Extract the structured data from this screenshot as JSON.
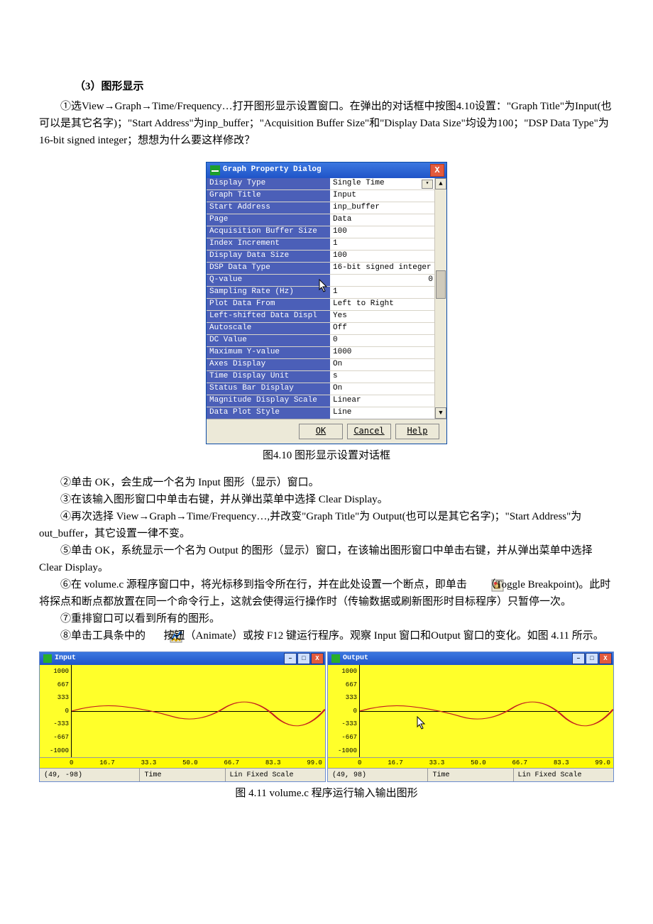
{
  "heading": "（3）图形显示",
  "para1": "①选View→Graph→Time/Frequency…打开图形显示设置窗口。在弹出的对话框中按图4.10设置：\"Graph Title\"为Input(也可以是其它名字)；\"Start Address\"为inp_buffer；\"Acquisition Buffer Size\"和\"Display Data Size\"均设为100；\"DSP Data Type\"为16-bit signed integer；想想为什么要这样修改？",
  "dialog": {
    "title": "Graph Property Dialog",
    "close_x": "X",
    "rows": [
      {
        "k": "Display Type",
        "v": "Single Time",
        "ext": true
      },
      {
        "k": "Graph Title",
        "v": "Input"
      },
      {
        "k": "Start Address",
        "v": "inp_buffer"
      },
      {
        "k": "Page",
        "v": "Data"
      },
      {
        "k": "Acquisition Buffer Size",
        "v": "100"
      },
      {
        "k": "Index Increment",
        "v": "1"
      },
      {
        "k": "Display Data Size",
        "v": "100"
      },
      {
        "k": "DSP Data Type",
        "v": "16-bit signed integer"
      },
      {
        "k": "Q-value",
        "v": "0",
        "cursor": true
      },
      {
        "k": "Sampling Rate (Hz)",
        "v": "1"
      },
      {
        "k": "Plot Data From",
        "v": "Left to Right"
      },
      {
        "k": "Left-shifted Data Displ",
        "v": "Yes"
      },
      {
        "k": "Autoscale",
        "v": "Off"
      },
      {
        "k": "DC Value",
        "v": "0"
      },
      {
        "k": "Maximum Y-value",
        "v": "1000"
      },
      {
        "k": "Axes Display",
        "v": "On"
      },
      {
        "k": "Time Display Unit",
        "v": "s"
      },
      {
        "k": "Status Bar Display",
        "v": "On"
      },
      {
        "k": "Magnitude Display Scale",
        "v": "Linear"
      },
      {
        "k": "Data Plot Style",
        "v": "Line"
      }
    ],
    "scrollbar": {
      "up": "▲",
      "down": "▼"
    },
    "buttons": {
      "ok": "OK",
      "cancel": "Cancel",
      "help": "Help"
    }
  },
  "caption410": "图4.10  图形显示设置对话框",
  "para2": "②单击 OK，会生成一个名为 Input 图形（显示）窗口。",
  "para3": "③在该输入图形窗口中单击右键，并从弹出菜单中选择 Clear Display。",
  "para4": "④再次选择 View→Graph→Time/Frequency…,并改变\"Graph  Title\"为 Output(也可以是其它名字)；\"Start Address\"为 out_buffer，其它设置一律不变。",
  "para5": "⑤单击 OK，系统显示一个名为 Output 的图形（显示）窗口，在该输出图形窗口中单击右键，并从弹出菜单中选择 Clear Display。",
  "para6a": "⑥在 volume.c 源程序窗口中，将光标移到指令所在行，并在此处设置一个断点，即单击",
  "para6b": "（Toggle Breakpoint)。此时将探点和断点都放置在同一个命令行上，这就会使得运行操作时（传输数据或刷新图形时目标程序）只暂停一次。",
  "para7": "⑦重排窗口可以看到所有的图形。",
  "para8a": "⑧单击工具条中的",
  "para8b": "按钮（Animate）或按 F12 键运行程序。观察 Input 窗口和Output 窗口的变化。如图 4.11 所示。",
  "graphs": {
    "input": {
      "title": "Input",
      "ylabels": [
        "1000",
        "667",
        "333",
        "0",
        "-333",
        "-667",
        "-1000"
      ],
      "xlabels": [
        "0",
        "16.7",
        "33.3",
        "50.0",
        "66.7",
        "83.3",
        "99.0"
      ],
      "status": {
        "coord": "(49, -98)",
        "mid": "Time",
        "right": "Lin  Fixed Scale"
      },
      "winbtns": {
        "min": "–",
        "max": "□",
        "close": "X"
      }
    },
    "output": {
      "title": "Output",
      "ylabels": [
        "1000",
        "667",
        "333",
        "0",
        "-333",
        "-667",
        "-1000"
      ],
      "xlabels": [
        "0",
        "16.7",
        "33.3",
        "50.0",
        "66.7",
        "83.3",
        "99.0"
      ],
      "status": {
        "coord": "(49, 98)",
        "mid": "Time",
        "right": "Lin  Fixed Scale"
      },
      "winbtns": {
        "min": "–",
        "max": "□",
        "close": "X"
      }
    }
  },
  "caption411": "图 4.11  volume.c 程序运行输入输出图形",
  "chart_data": [
    {
      "type": "line",
      "title": "Input",
      "xlabel": "Time",
      "ylabel": "",
      "xlim": [
        0,
        99
      ],
      "ylim": [
        -1000,
        1000
      ],
      "x": [
        0,
        10,
        20,
        30,
        40,
        50,
        60,
        70,
        80,
        90,
        99
      ],
      "series": [
        {
          "name": "Input",
          "values": [
            0,
            90,
            130,
            70,
            -60,
            -130,
            -90,
            30,
            120,
            110,
            10
          ]
        }
      ]
    },
    {
      "type": "line",
      "title": "Output",
      "xlabel": "Time",
      "ylabel": "",
      "xlim": [
        0,
        99
      ],
      "ylim": [
        -1000,
        1000
      ],
      "x": [
        0,
        10,
        20,
        30,
        40,
        50,
        60,
        70,
        80,
        90,
        99
      ],
      "series": [
        {
          "name": "Output",
          "values": [
            0,
            90,
            130,
            70,
            -60,
            -130,
            -90,
            30,
            120,
            110,
            10
          ]
        }
      ]
    }
  ]
}
